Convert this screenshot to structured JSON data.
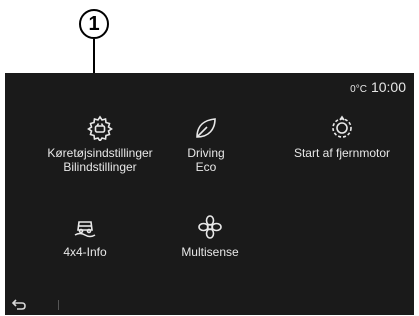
{
  "callout": {
    "number": "1"
  },
  "status": {
    "temperature": "0°C",
    "time": "10:00"
  },
  "tiles": [
    {
      "icon": "vehicle-settings-gear-icon",
      "line1": "Køretøjsindstillinger",
      "line2": "Bilindstillinger"
    },
    {
      "icon": "eco-leaf-icon",
      "line1": "Driving",
      "line2": "Eco"
    },
    {
      "icon": "remote-start-icon",
      "line1": "Start af fjernmotor",
      "line2": ""
    },
    {
      "icon": "4x4-terrain-icon",
      "line1": "4x4-Info",
      "line2": ""
    },
    {
      "icon": "multisense-fan-icon",
      "line1": "Multisense",
      "line2": ""
    }
  ],
  "nav": {
    "back_icon": "back-arrow-icon"
  }
}
